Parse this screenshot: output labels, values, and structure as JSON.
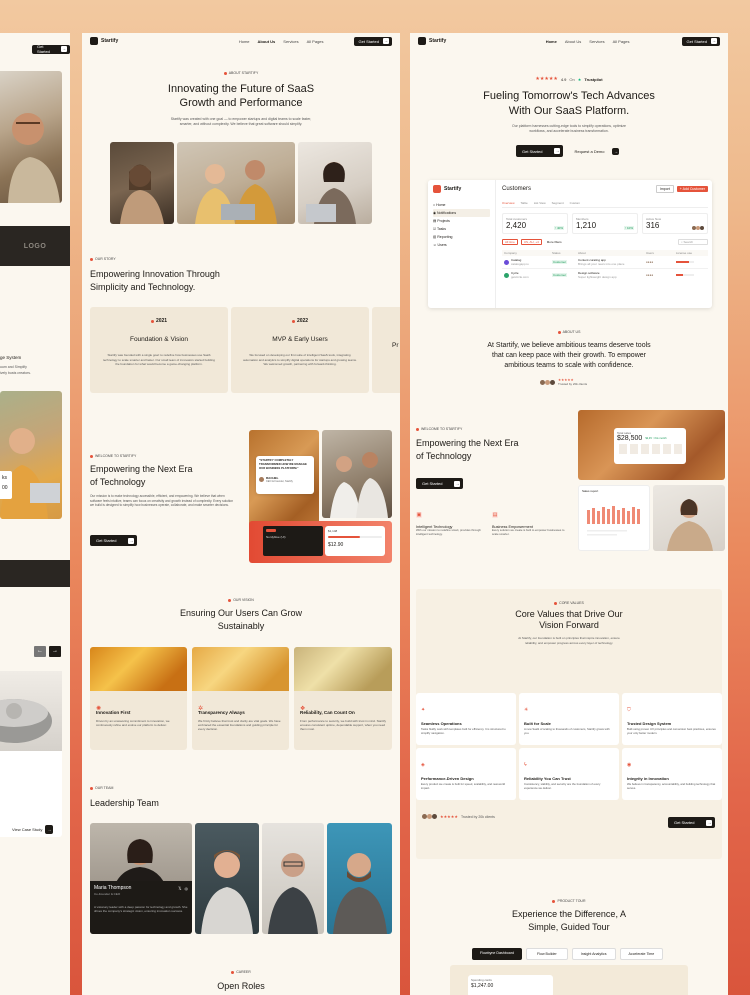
{
  "left": {
    "get_started": "Get Started",
    "logo_text": "LOGO",
    "system_text": "ge System",
    "desc_1": "uum and Simplify",
    "desc_2": "ively busts creators.",
    "view_case": "View Case Study",
    "figures": [
      "ks",
      "00"
    ]
  },
  "center": {
    "brand": "Startify",
    "nav": [
      "Home",
      "About Us",
      "Services",
      "All Pages"
    ],
    "nav_cta": "Get Started",
    "hero_tag": "ABOUT STARTIFY",
    "hero_title_1": "Innovating the Future of SaaS",
    "hero_title_2": "Growth and Performance",
    "hero_desc_1": "Startify was created with one goal — to empower startups and digital teams to scale faster,",
    "hero_desc_2": "smarter, and without complexity. We believe that great software should simplify.",
    "story_tag": "OUR STORY",
    "story_title_1": "Empowering Innovation Through",
    "story_title_2": "Simplicity and Technology.",
    "timeline": [
      {
        "year": "2021",
        "title": "Foundation & Vision",
        "desc": "Startify was founded with a single goal: to redefine how businesses use SaaS technology to scale smarter and faster. Our small team of innovators started building the foundation for what would become a game-changing platform."
      },
      {
        "year": "2022",
        "title": "MVP & Early Users",
        "desc": "We focused on developing our first suite of intelligent SaaS tools, integrating automation and analytics to simplify digital operations for startups and growing teams. We welcomed growth, partnering with forward-thinking."
      },
      {
        "year": "",
        "title": "Pr",
        "desc": ""
      }
    ],
    "welcome_tag": "WELCOME TO STARTIFY",
    "welcome_title_1": "Empowering the Next Era",
    "welcome_title_2": "of Technology",
    "welcome_desc": "Our mission is to make technology accessible, efficient, and empowering. We believe that when software feels intuitive, teams can focus on creativity and growth instead of complexity. Every solution we build is designed to simplify how businesses operate, collaborate, and make smarter decisions.",
    "welcome_cta": "Get Started",
    "quote": "\"STARTIFY COMPLETELY TRANSFORMED HOW WE MANAGE OUR BUSINESS PLATFORM.\"",
    "quote_name": "RACHEL",
    "quote_role": "CEO & Founder, Startify",
    "card_name": "Nordyblue (UI)",
    "card_amount": "$12.90",
    "card_small": "$1,148",
    "vision_tag": "OUR VISION",
    "vision_title_1": "Ensuring Our Users Can Grow",
    "vision_title_2": "Sustainably",
    "values": [
      {
        "title": "Innovation First",
        "desc": "Driven by an unwavering commitment to innovation, we continuously refine and evolve our platform to deliver."
      },
      {
        "title": "Transparency Always",
        "desc": "We firmly believe that trust and clarity are vital goals. We have embraced the essential foundations and guiding principle for every decision."
      },
      {
        "title": "Reliability, Can Count On",
        "desc": "From performance to security, we build with trust in mind. Startify ensures consistent uptime, dependable support, when you need them most."
      }
    ],
    "team_tag": "OUR TEAM",
    "team_title": "Leadership Team",
    "leader_name": "Maria Thompson",
    "leader_role": "Co-Founder & CEO",
    "leader_desc": "A visionary leader with a deep passion for technology and growth. She drives the company's strategic vision, ensuring innovation success.",
    "careers_tag": "CAREER",
    "careers_title": "Open Roles"
  },
  "right": {
    "brand": "Startify",
    "nav": [
      "Home",
      "About Us",
      "Services",
      "All Pages"
    ],
    "nav_cta": "Get Started",
    "rating_label": "On",
    "rating_source": "Trustpilot",
    "rating_score": "4.9",
    "hero_title_1": "Fueling Tomorrow's Tech Advances",
    "hero_title_2": "With Our SaaS Platform.",
    "hero_desc_1": "Our platform harnesses cutting-edge tools to simplify operations, optimize",
    "hero_desc_2": "workflows, and accelerate business transformation.",
    "cta_primary": "Get Started",
    "cta_secondary": "Request a Demo",
    "dash": {
      "brand": "Startify",
      "title": "Customers",
      "import": "Import",
      "add": "+ Add Customer",
      "menu": [
        "Home",
        "Notifications",
        "Projects",
        "Tasks",
        "Reporting",
        "Users"
      ],
      "tabs": [
        "Overview",
        "Table",
        "List View",
        "Segment",
        "Custom"
      ],
      "stats": [
        {
          "label": "Total customers",
          "value": "2,420",
          "delta": "↑ 40%"
        },
        {
          "label": "Members",
          "value": "1,210",
          "delta": "↑ 10%"
        },
        {
          "label": "Active Now",
          "value": "316",
          "delta": ""
        }
      ],
      "filters": [
        "All time",
        "US, AU, +4",
        "More filters"
      ],
      "search": "Search",
      "columns": [
        "Company",
        "Status",
        "About",
        "Users",
        "License use"
      ],
      "rows": [
        {
          "company": "Catalog",
          "url": "catalogapp.io",
          "status": "Customer",
          "about": "Content curating app",
          "about2": "Brings all your news into one place"
        },
        {
          "company": "Cycle",
          "url": "getcircle.com",
          "status": "Customer",
          "about": "Design software",
          "about2": "Super lightweight design app"
        }
      ]
    },
    "mission_tag": "ABOUT US",
    "mission_1": "At Startify, we believe ambitious teams deserve tools",
    "mission_2": "that can keep pace with their growth. To empower",
    "mission_3": "ambitious teams to scale with confidence.",
    "trust_small": "Trusted by 20k clients",
    "welcome_tag": "WELCOME TO STARTIFY",
    "welcome_title_1": "Empowering the Next Era",
    "welcome_title_2": "of Technology",
    "welcome_cta": "Get Started",
    "features": [
      {
        "title": "Intelligent Technology",
        "desc": "With our mission to redefine smart, provides through intelligent technology."
      },
      {
        "title": "Business Empowerment",
        "desc": "Every solution we create is built to empower businesses to scale smarter."
      }
    ],
    "total_sales_label": "Total sales",
    "total_sales_value": "$28,500",
    "total_sales_delta": "$2,45 ↑ this month",
    "sales_label": "Sales report",
    "core_tag": "CORE VALUES",
    "core_title_1": "Core Values that Drive Our",
    "core_title_2": "Vision Forward",
    "core_desc_1": "At Startify, our foundation is built on principles that inspire innovation, ensure",
    "core_desc_2": "reliability, and empower progress across every layer of technology.",
    "core_values": [
      {
        "title": "Seamless Operations",
        "desc": "Tasks fluidly work with templates built for efficiency. It is structured to simplify navigation."
      },
      {
        "title": "Built for Scale",
        "desc": "A new SaaS of scaling to thousands of customers, Startify grows with you."
      },
      {
        "title": "Trusted Design System",
        "desc": "Built using proven UX principles and conversion best practices, ensures your only better modern."
      },
      {
        "title": "Performance-Driven Design",
        "desc": "Every product we create is built for speed, scalability, and real-world impact."
      },
      {
        "title": "Reliability You Can Trust",
        "desc": "Consistency, stability, and security are the foundation of every experience we deliver."
      },
      {
        "title": "Integrity in Innovation",
        "desc": "We believe in transparency, accountability, and building technology that serves."
      }
    ],
    "trusted": "Trusted by 20k clients",
    "trusted_cta": "Get Started",
    "tour_tag": "PRODUCT TOUR",
    "tour_title_1": "Experience the Difference, A",
    "tour_title_2": "Simple, Guided Tour",
    "tour_tabs": [
      "Flowbyne Dashboard",
      "Flow Builder",
      "Insight Analytics",
      "Accelerate Time"
    ],
    "tour_label": "Spending cards",
    "tour_value": "$1,247.00"
  },
  "colors": {
    "accent": "#e5533b",
    "dark": "#1d1a16",
    "cream": "#fbf7ef"
  }
}
